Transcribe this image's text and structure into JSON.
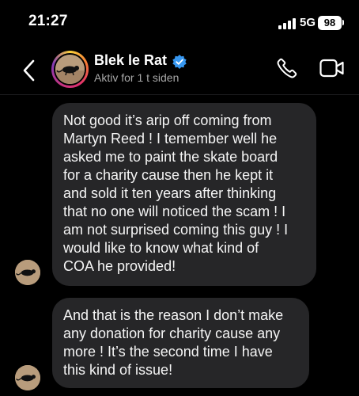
{
  "status_bar": {
    "time": "21:27",
    "network": "5G",
    "battery": "98"
  },
  "header": {
    "contact_name": "Blek le Rat",
    "active_status": "Aktiv for 1 t siden",
    "verified": true,
    "verified_color": "#3797f0",
    "icons": [
      "back-icon",
      "verified-badge-icon",
      "phone-icon",
      "video-camera-icon"
    ]
  },
  "messages": [
    {
      "sender": "Blek le Rat",
      "text": "Not good it’s arip off coming from\nMartyn Reed ! I temember well  he\nasked me to paint the skate board\nfor a charity cause then he kept it\nand sold it ten years after thinking\nthat no one will noticed the scam ! I\nam not surprised coming this guy ! I\nwould like to know what kind of\nCOA he provided!"
    },
    {
      "sender": "Blek le Rat",
      "text": "And that is the reason I don’t make\nany donation for charity cause any\nmore ! It’s the second time I have\nthis kind of issue!"
    }
  ],
  "colors": {
    "background": "#000000",
    "bubble": "#262628",
    "secondary_text": "#a8a8a8"
  }
}
